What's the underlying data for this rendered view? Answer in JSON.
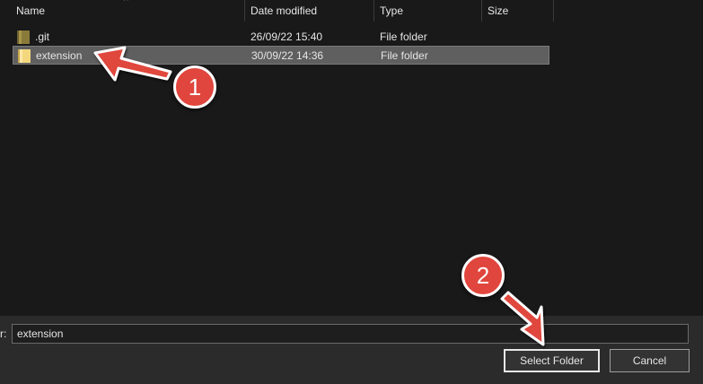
{
  "colors": {
    "background": "#191919",
    "selected_row": "#5f5f5f",
    "bottom_panel": "#2b2b2b",
    "annotation_red": "#e0463d",
    "folder_git": "#8a7a3a",
    "folder_open": "#e8c96a"
  },
  "columns": {
    "name": "Name",
    "date": "Date modified",
    "type": "Type",
    "size": "Size"
  },
  "files": [
    {
      "name": ".git",
      "date": "26/09/22 15:40",
      "type": "File folder",
      "icon": "folder-icon",
      "selected": false
    },
    {
      "name": "extension",
      "date": "30/09/22 14:36",
      "type": "File folder",
      "icon": "folder-icon",
      "selected": true
    }
  ],
  "bottom": {
    "label_fragment": "r:",
    "folder_value": "extension",
    "select_label": "Select Folder",
    "cancel_label": "Cancel"
  },
  "annotations": {
    "step1": "1",
    "step2": "2"
  }
}
